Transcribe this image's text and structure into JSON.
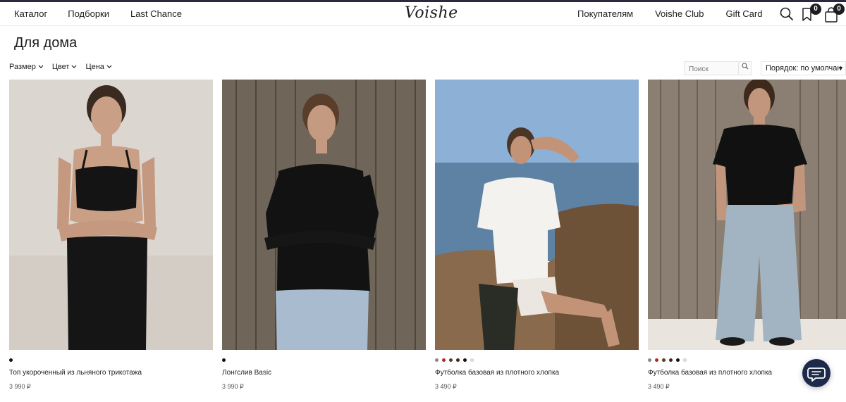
{
  "header": {
    "nav_left": [
      "Каталог",
      "Подборки",
      "Last Chance"
    ],
    "logo": "Voishe",
    "nav_right": [
      "Покупателям",
      "Voishe Club",
      "Gift Card"
    ],
    "favorites_count": "0",
    "cart_count": "0"
  },
  "page": {
    "title": "Для дома"
  },
  "filters": {
    "size": "Размер",
    "color": "Цвет",
    "price": "Цена"
  },
  "search": {
    "placeholder": "Поиск"
  },
  "sort": {
    "label": "Порядок: по умолчан"
  },
  "products": [
    {
      "name": "Топ укороченный из льняного трикотажа",
      "price": "3 990 ₽",
      "swatches": [
        "#111111"
      ]
    },
    {
      "name": "Лонгслив Basic",
      "price": "3 990 ₽",
      "swatches": [
        "#111111"
      ]
    },
    {
      "name": "Футболка базовая из плотного хлопка",
      "price": "3 490 ₽",
      "swatches": [
        "#8a8a7a",
        "#b32a2a",
        "#5a3a2a",
        "#3a2a1a",
        "#111111",
        "#e6e2da"
      ]
    },
    {
      "name": "Футболка базовая из плотного хлопка",
      "price": "3 490 ₽",
      "swatches": [
        "#8a8a7a",
        "#b32a2a",
        "#5a3a2a",
        "#3a2a1a",
        "#111111",
        "#e6e2da"
      ]
    }
  ],
  "colors": {
    "accent": "#1e2a4a",
    "topline": "#2a2a3e"
  },
  "icons": [
    "search-icon",
    "bookmark-icon",
    "shopping-bag-icon",
    "chat-icon"
  ]
}
